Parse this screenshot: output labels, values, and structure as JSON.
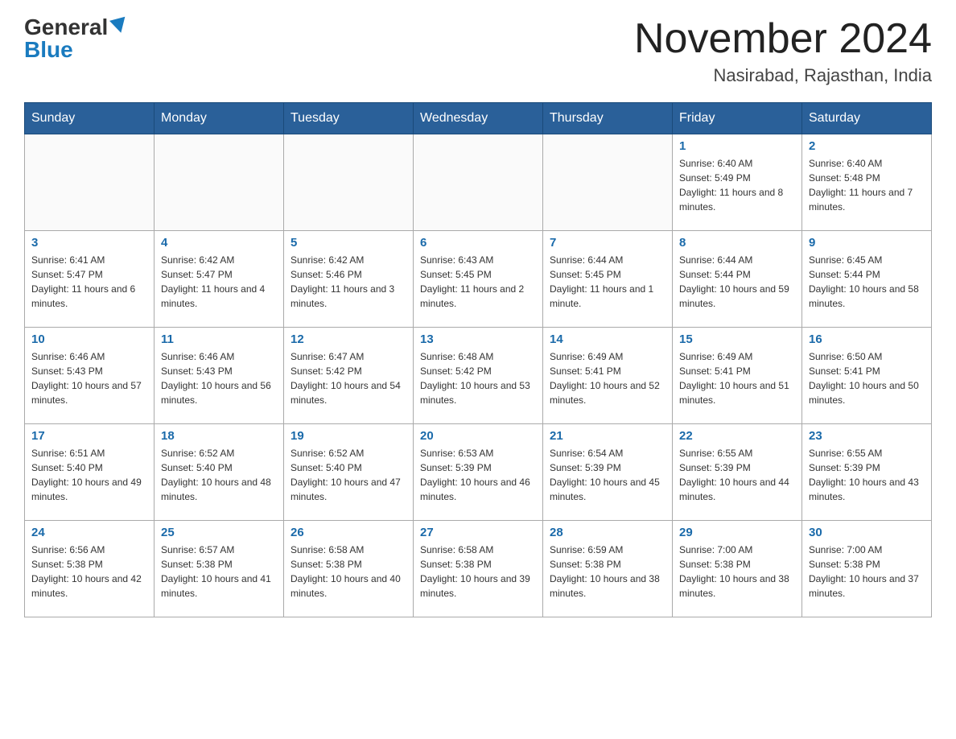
{
  "header": {
    "logo": {
      "general": "General",
      "blue": "Blue"
    },
    "title": "November 2024",
    "location": "Nasirabad, Rajasthan, India"
  },
  "weekdays": [
    "Sunday",
    "Monday",
    "Tuesday",
    "Wednesday",
    "Thursday",
    "Friday",
    "Saturday"
  ],
  "weeks": [
    [
      {
        "day": "",
        "info": ""
      },
      {
        "day": "",
        "info": ""
      },
      {
        "day": "",
        "info": ""
      },
      {
        "day": "",
        "info": ""
      },
      {
        "day": "",
        "info": ""
      },
      {
        "day": "1",
        "info": "Sunrise: 6:40 AM\nSunset: 5:49 PM\nDaylight: 11 hours and 8 minutes."
      },
      {
        "day": "2",
        "info": "Sunrise: 6:40 AM\nSunset: 5:48 PM\nDaylight: 11 hours and 7 minutes."
      }
    ],
    [
      {
        "day": "3",
        "info": "Sunrise: 6:41 AM\nSunset: 5:47 PM\nDaylight: 11 hours and 6 minutes."
      },
      {
        "day": "4",
        "info": "Sunrise: 6:42 AM\nSunset: 5:47 PM\nDaylight: 11 hours and 4 minutes."
      },
      {
        "day": "5",
        "info": "Sunrise: 6:42 AM\nSunset: 5:46 PM\nDaylight: 11 hours and 3 minutes."
      },
      {
        "day": "6",
        "info": "Sunrise: 6:43 AM\nSunset: 5:45 PM\nDaylight: 11 hours and 2 minutes."
      },
      {
        "day": "7",
        "info": "Sunrise: 6:44 AM\nSunset: 5:45 PM\nDaylight: 11 hours and 1 minute."
      },
      {
        "day": "8",
        "info": "Sunrise: 6:44 AM\nSunset: 5:44 PM\nDaylight: 10 hours and 59 minutes."
      },
      {
        "day": "9",
        "info": "Sunrise: 6:45 AM\nSunset: 5:44 PM\nDaylight: 10 hours and 58 minutes."
      }
    ],
    [
      {
        "day": "10",
        "info": "Sunrise: 6:46 AM\nSunset: 5:43 PM\nDaylight: 10 hours and 57 minutes."
      },
      {
        "day": "11",
        "info": "Sunrise: 6:46 AM\nSunset: 5:43 PM\nDaylight: 10 hours and 56 minutes."
      },
      {
        "day": "12",
        "info": "Sunrise: 6:47 AM\nSunset: 5:42 PM\nDaylight: 10 hours and 54 minutes."
      },
      {
        "day": "13",
        "info": "Sunrise: 6:48 AM\nSunset: 5:42 PM\nDaylight: 10 hours and 53 minutes."
      },
      {
        "day": "14",
        "info": "Sunrise: 6:49 AM\nSunset: 5:41 PM\nDaylight: 10 hours and 52 minutes."
      },
      {
        "day": "15",
        "info": "Sunrise: 6:49 AM\nSunset: 5:41 PM\nDaylight: 10 hours and 51 minutes."
      },
      {
        "day": "16",
        "info": "Sunrise: 6:50 AM\nSunset: 5:41 PM\nDaylight: 10 hours and 50 minutes."
      }
    ],
    [
      {
        "day": "17",
        "info": "Sunrise: 6:51 AM\nSunset: 5:40 PM\nDaylight: 10 hours and 49 minutes."
      },
      {
        "day": "18",
        "info": "Sunrise: 6:52 AM\nSunset: 5:40 PM\nDaylight: 10 hours and 48 minutes."
      },
      {
        "day": "19",
        "info": "Sunrise: 6:52 AM\nSunset: 5:40 PM\nDaylight: 10 hours and 47 minutes."
      },
      {
        "day": "20",
        "info": "Sunrise: 6:53 AM\nSunset: 5:39 PM\nDaylight: 10 hours and 46 minutes."
      },
      {
        "day": "21",
        "info": "Sunrise: 6:54 AM\nSunset: 5:39 PM\nDaylight: 10 hours and 45 minutes."
      },
      {
        "day": "22",
        "info": "Sunrise: 6:55 AM\nSunset: 5:39 PM\nDaylight: 10 hours and 44 minutes."
      },
      {
        "day": "23",
        "info": "Sunrise: 6:55 AM\nSunset: 5:39 PM\nDaylight: 10 hours and 43 minutes."
      }
    ],
    [
      {
        "day": "24",
        "info": "Sunrise: 6:56 AM\nSunset: 5:38 PM\nDaylight: 10 hours and 42 minutes."
      },
      {
        "day": "25",
        "info": "Sunrise: 6:57 AM\nSunset: 5:38 PM\nDaylight: 10 hours and 41 minutes."
      },
      {
        "day": "26",
        "info": "Sunrise: 6:58 AM\nSunset: 5:38 PM\nDaylight: 10 hours and 40 minutes."
      },
      {
        "day": "27",
        "info": "Sunrise: 6:58 AM\nSunset: 5:38 PM\nDaylight: 10 hours and 39 minutes."
      },
      {
        "day": "28",
        "info": "Sunrise: 6:59 AM\nSunset: 5:38 PM\nDaylight: 10 hours and 38 minutes."
      },
      {
        "day": "29",
        "info": "Sunrise: 7:00 AM\nSunset: 5:38 PM\nDaylight: 10 hours and 38 minutes."
      },
      {
        "day": "30",
        "info": "Sunrise: 7:00 AM\nSunset: 5:38 PM\nDaylight: 10 hours and 37 minutes."
      }
    ]
  ]
}
